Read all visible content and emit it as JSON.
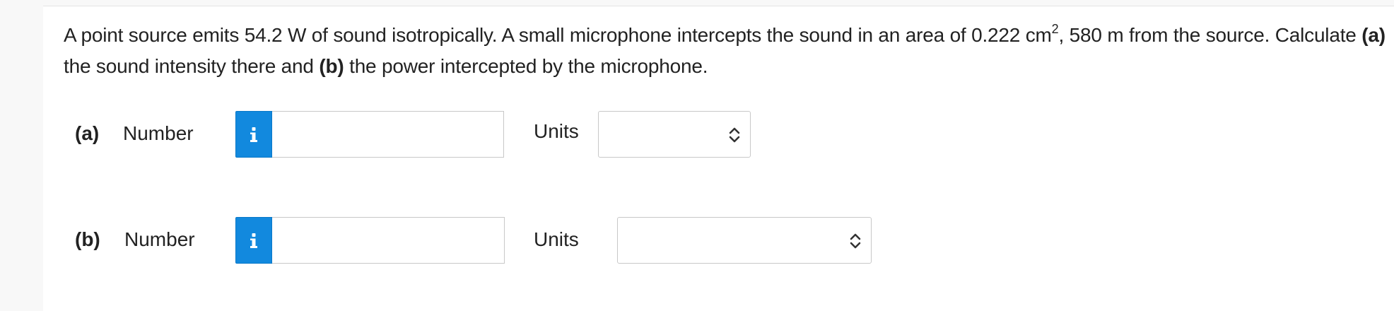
{
  "question": {
    "part1": "A point source emits 54.2 W of sound isotropically. A small microphone intercepts the sound in an area of 0.222 cm",
    "sup": "2",
    "part2": ", 580 m from the source. Calculate ",
    "a_marker": "(a)",
    "part3": " the sound intensity there and ",
    "b_marker": "(b)",
    "part4": " the power intercepted by the microphone."
  },
  "answers": [
    {
      "part": "(a)",
      "number_label": "Number",
      "info_icon": "i",
      "number_value": "",
      "units_label": "Units",
      "units_value": "",
      "chevron_icon": "up-down-chevron-icon"
    },
    {
      "part": "(b)",
      "number_label": "Number",
      "info_icon": "i",
      "number_value": "",
      "units_label": "Units",
      "units_value": "",
      "chevron_icon": "up-down-chevron-icon"
    }
  ],
  "colors": {
    "info_button": "#1289de",
    "page_background": "#f8f8f8",
    "card_background": "#ffffff",
    "text": "#222222"
  }
}
